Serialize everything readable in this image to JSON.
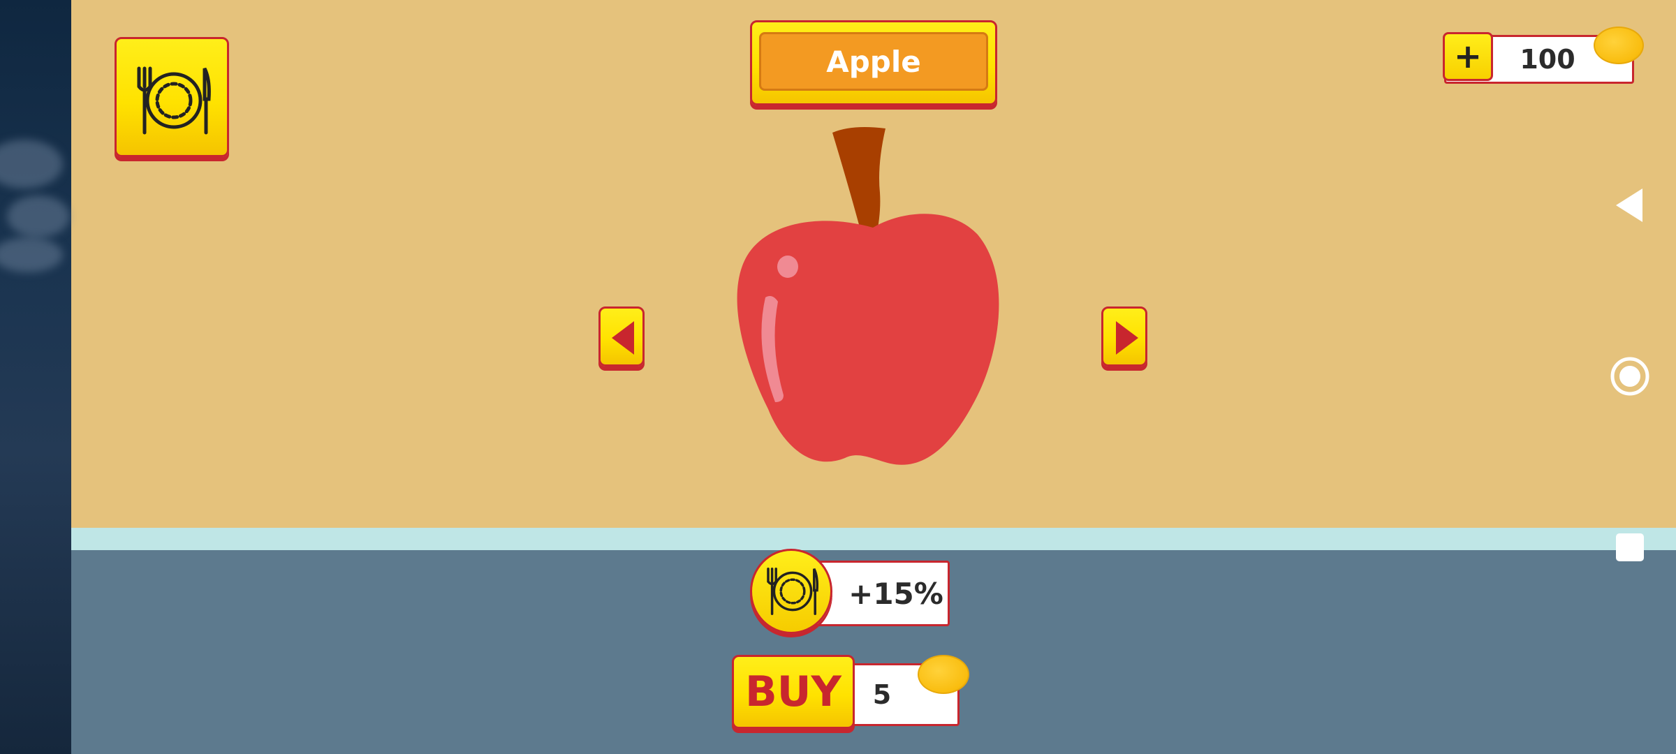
{
  "item": {
    "name": "Apple",
    "bonus": "+15%",
    "price": "5"
  },
  "wallet": {
    "coins": "100",
    "add_label": "+"
  },
  "buttons": {
    "buy_label": "BUY"
  },
  "icons": {
    "menu": "plate-fork-knife-icon",
    "coin": "coin-icon",
    "prev": "arrow-left-icon",
    "next": "arrow-right-icon",
    "nav_back": "nav-back-icon",
    "nav_home": "nav-home-icon",
    "nav_recent": "nav-recent-icon"
  },
  "colors": {
    "background": "#e5c27c",
    "accent_yellow": "#ffe200",
    "accent_red": "#c8262e",
    "banner_orange": "#f39a22",
    "bottom_panel": "#5d7a8e",
    "apple_red": "#e24141"
  }
}
